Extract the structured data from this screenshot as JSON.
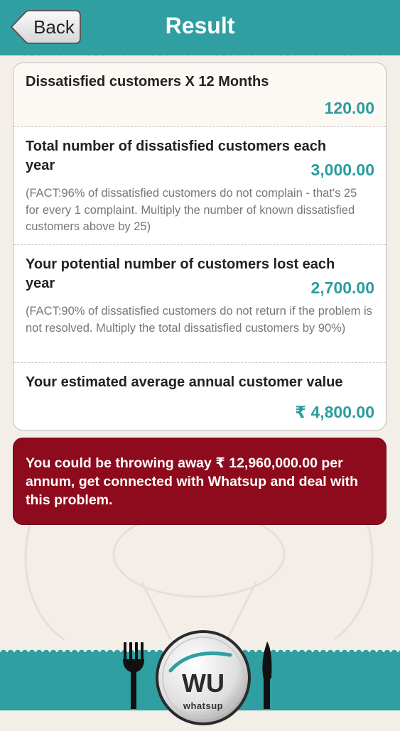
{
  "header": {
    "back_label": "Back",
    "title": "Result"
  },
  "results": [
    {
      "label": "Dissatisfied customers X 12 Months",
      "value": "120.00"
    },
    {
      "label_line1": "Total number of dissatisfied customers each",
      "label_line2": "year",
      "value": "3,000.00",
      "fact": "(FACT:96% of dissatisfied customers do not complain - that's 25 for every 1 complaint. Multiply the number of known dissatisfied customers above by 25)"
    },
    {
      "label_line1": "Your potential number of customers lost each",
      "label_line2": "year",
      "value": "2,700.00",
      "fact": "(FACT:90% of dissatisfied customers do not return if the problem is not resolved. Multiply the total dissatisfied customers by 90%)"
    },
    {
      "label": "Your estimated average annual customer value",
      "value": "₹ 4,800.00"
    }
  ],
  "alert": {
    "text": "You could be throwing away ₹ 12,960,000.00 per annum, get connected with Whatsup and deal with this problem."
  },
  "footer": {
    "logo_mark": "WU",
    "logo_word": "whatsup"
  },
  "colors": {
    "accent": "#2f9fa1",
    "value_text": "#2b9c9e",
    "alert_bg": "#8d0b1d"
  }
}
